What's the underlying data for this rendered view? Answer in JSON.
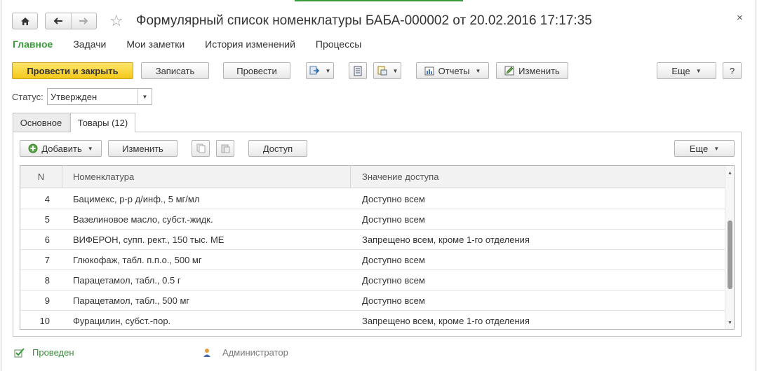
{
  "window": {
    "title": "Формулярный список номенклатуры БАБА-000002 от 20.02.2016 17:17:35",
    "close_glyph": "×"
  },
  "section_nav": [
    {
      "label": "Главное",
      "active": true
    },
    {
      "label": "Задачи",
      "active": false
    },
    {
      "label": "Мои заметки",
      "active": false
    },
    {
      "label": "История изменений",
      "active": false
    },
    {
      "label": "Процессы",
      "active": false
    }
  ],
  "toolbar": {
    "post_and_close": "Провести и закрыть",
    "save": "Записать",
    "post": "Провести",
    "reports": "Отчеты",
    "edit": "Изменить",
    "more": "Еще",
    "help": "?"
  },
  "status": {
    "label": "Статус:",
    "value": "Утвержден"
  },
  "tabs": [
    {
      "label": "Основное",
      "active": false
    },
    {
      "label": "Товары (12)",
      "active": true
    }
  ],
  "table_toolbar": {
    "add": "Добавить",
    "edit": "Изменить",
    "access": "Доступ",
    "more": "Еще"
  },
  "table": {
    "columns": [
      "N",
      "Номенклатура",
      "Значение доступа"
    ],
    "rows": [
      {
        "n": "4",
        "name": "Бацимекс, р-р д/инф., 5 мг/мл",
        "access": "Доступно всем"
      },
      {
        "n": "5",
        "name": "Вазелиновое масло, субст.-жидк.",
        "access": "Доступно всем"
      },
      {
        "n": "6",
        "name": "ВИФЕРОН, супп. рект., 150 тыс. МЕ",
        "access": "Запрещено всем, кроме 1-го отделения"
      },
      {
        "n": "7",
        "name": "Глюкофаж, табл. п.п.о., 500 мг",
        "access": "Доступно всем"
      },
      {
        "n": "8",
        "name": "Парацетамол, табл., 0.5 г",
        "access": "Доступно всем"
      },
      {
        "n": "9",
        "name": "Парацетамол, табл., 500 мг",
        "access": "Доступно всем"
      },
      {
        "n": "10",
        "name": "Фурацилин, субст.-пор.",
        "access": "Запрещено всем, кроме 1-го отделения"
      }
    ]
  },
  "footer": {
    "posted": "Проведен",
    "user": "Администратор"
  },
  "colors": {
    "accent_green": "#3a9a3a",
    "primary_button": "#f4c81b"
  }
}
